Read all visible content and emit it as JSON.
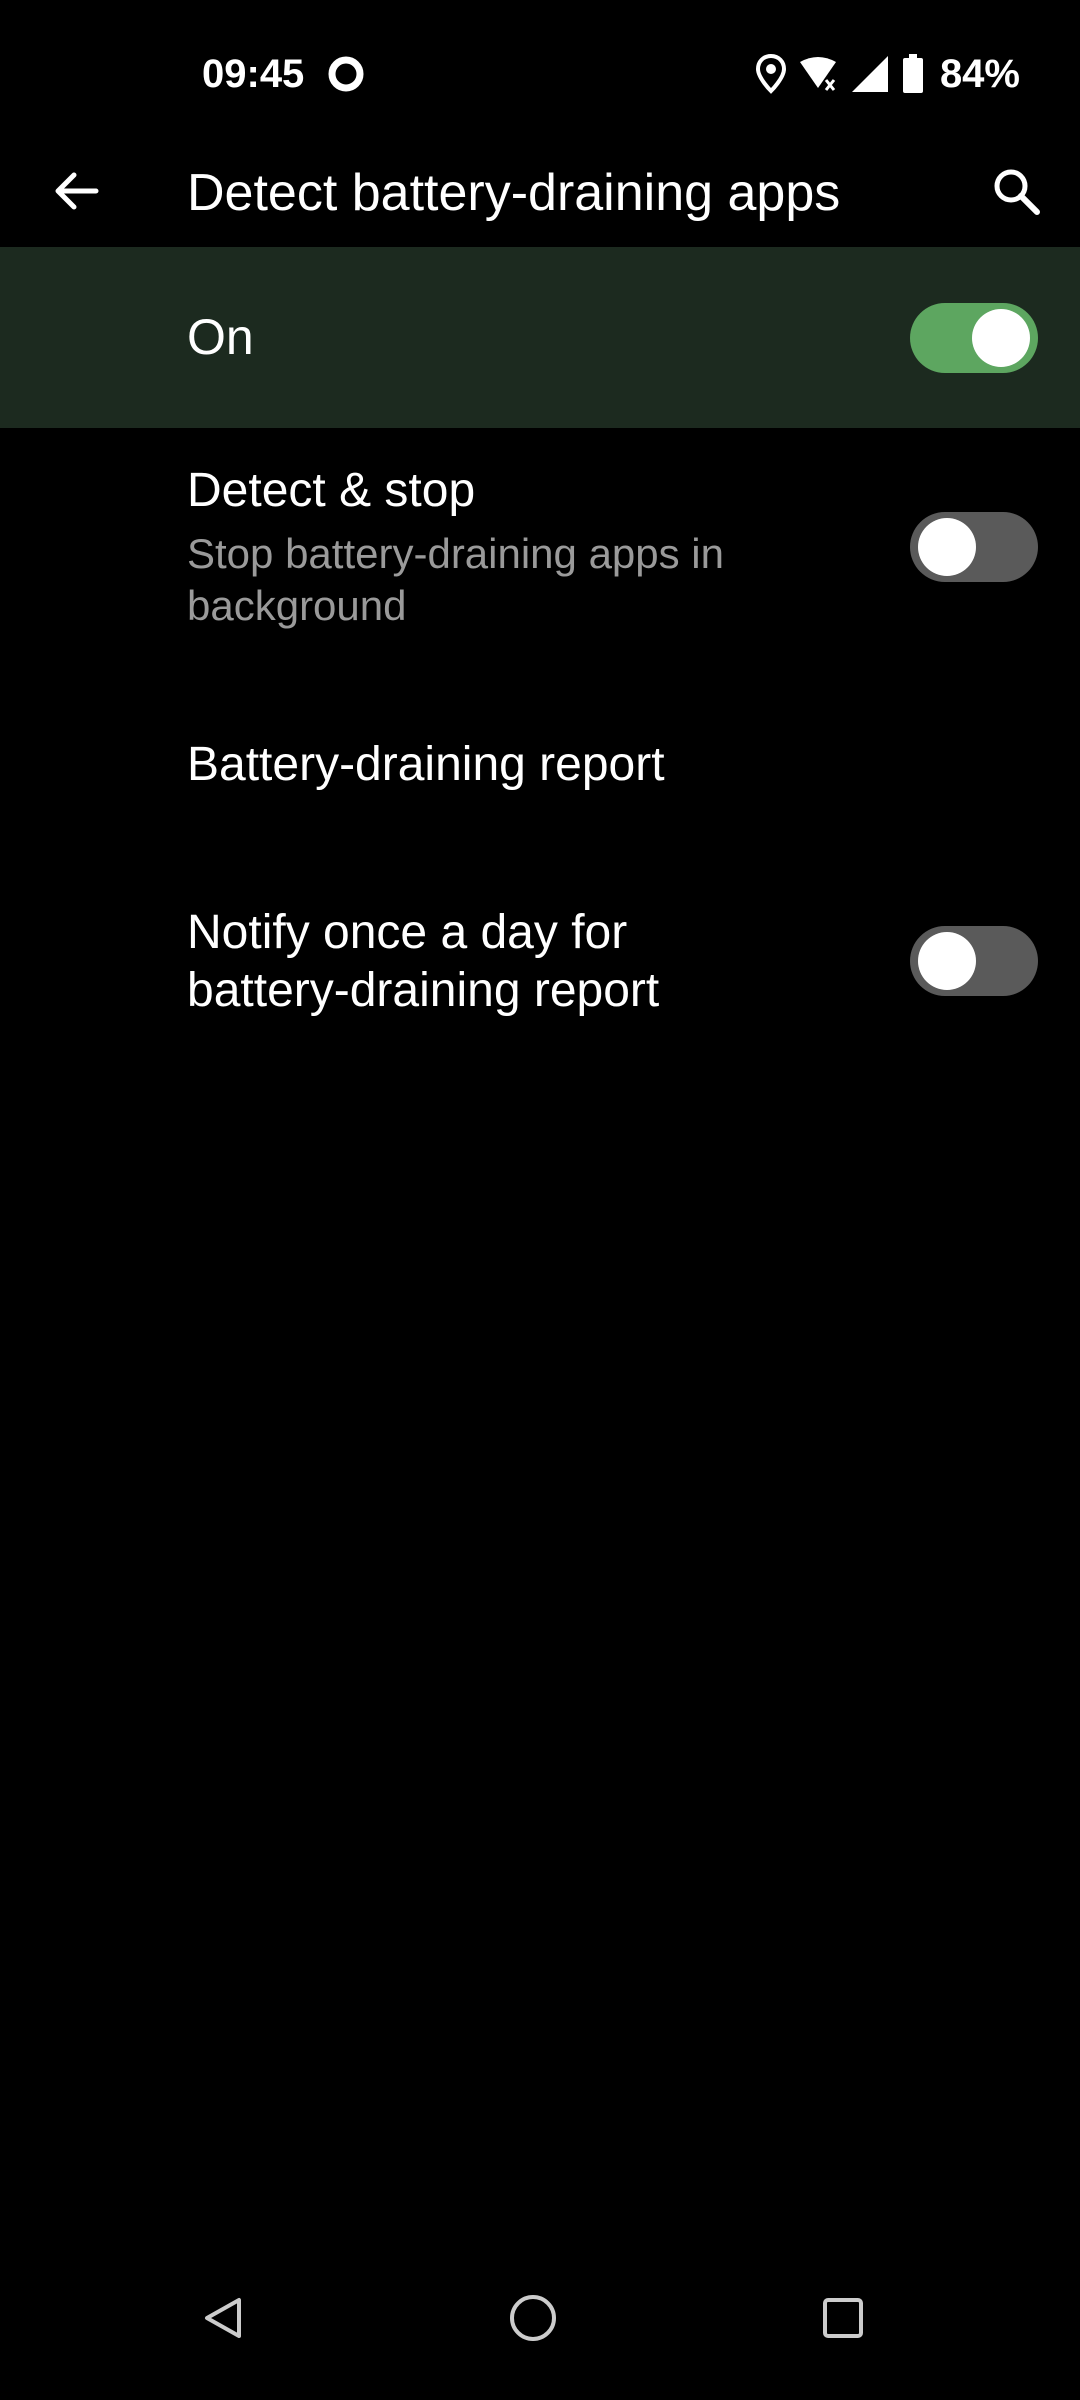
{
  "status_bar": {
    "time": "09:45",
    "battery_percent": "84%",
    "icons": [
      "record-icon",
      "location-icon",
      "wifi-icon",
      "cell-signal-icon",
      "battery-icon"
    ]
  },
  "app_bar": {
    "title": "Detect battery-draining apps",
    "back_icon": "arrow-back-icon",
    "search_icon": "search-icon"
  },
  "master_switch": {
    "label": "On",
    "checked": true
  },
  "settings": [
    {
      "title": "Detect & stop",
      "summary": "Stop battery-draining apps in background",
      "toggle": "off"
    },
    {
      "title": "Battery-draining report"
    },
    {
      "title": "Notify once a day for battery-draining report",
      "toggle": "off"
    }
  ],
  "nav_bar": {
    "icons": [
      "back-triangle-icon",
      "home-circle-icon",
      "recents-square-icon"
    ]
  },
  "colors": {
    "background": "#000000",
    "master_row_bg": "#1c2a1f",
    "switch_on": "#5da660",
    "switch_off": "#5a5a5a",
    "summary_text": "#9a9a9a"
  }
}
